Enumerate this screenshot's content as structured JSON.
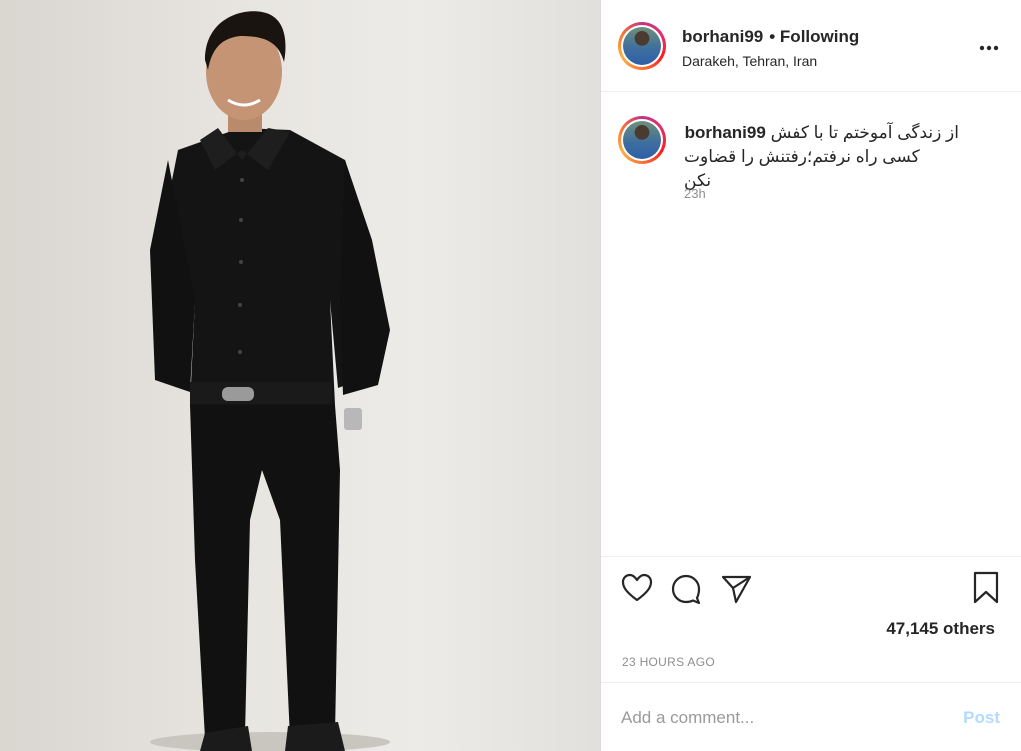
{
  "post": {
    "username": "borhani99",
    "follow_status": "• Following",
    "location": "Darakeh, Tehran, Iran",
    "more_icon": "more-horizontal-icon"
  },
  "caption": {
    "username": "borhani99",
    "line1": "از زندگی آموختم تا با کفش",
    "line2": "کسی راه نرفتم؛رفتنش را قضاوت نکن",
    "time": "23h"
  },
  "actions": {
    "icons": [
      "heart-icon",
      "comment-icon",
      "share-icon",
      "bookmark-icon"
    ],
    "likes": "47,145 others",
    "posted": "23 HOURS AGO"
  },
  "comment": {
    "placeholder": "Add a comment...",
    "post_label": "Post",
    "post_color": "#b3dbff"
  }
}
